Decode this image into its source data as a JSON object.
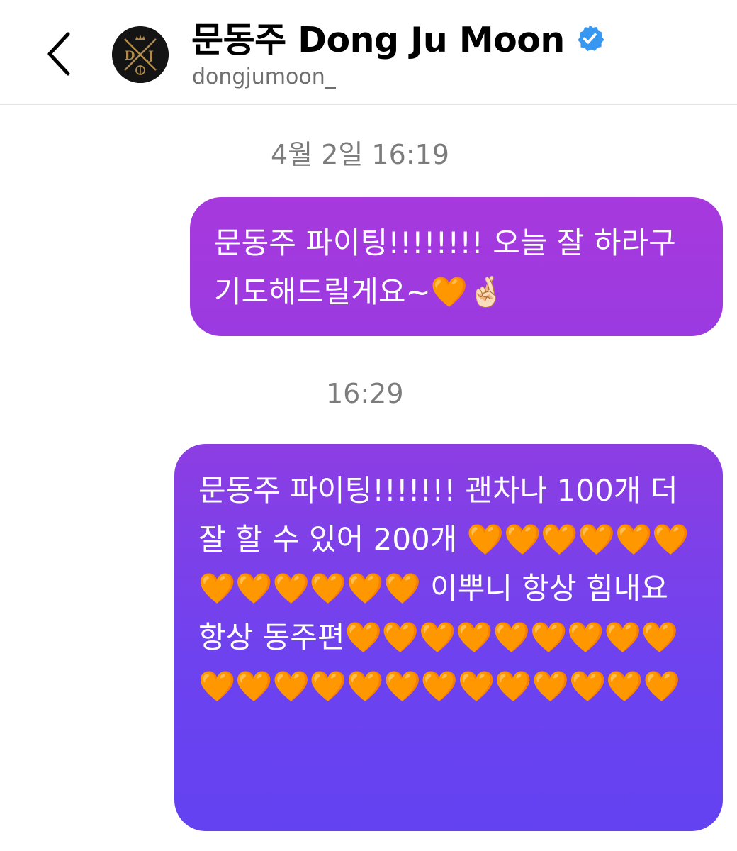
{
  "header": {
    "title": "문동주 Dong Ju Moon",
    "handle": "dongjumoon_",
    "back_icon": "chevron-left-icon",
    "verified_icon": "verified-badge-icon",
    "avatar_icon": "team-logo-avatar",
    "verified_color": "#3897f0"
  },
  "messages": [
    {
      "timestamp": "4월 2일 16:19",
      "text": "문동주 파이팅!!!!!!!! 오늘 잘 하라구 기도해드릴게요~🧡🤞🏻",
      "color": "#a33ade"
    },
    {
      "timestamp": "16:29",
      "text": "문동주 파이팅!!!!!!! 괜차나 100개 더 잘 할 수 있어 200개 🧡🧡🧡🧡🧡🧡🧡🧡🧡🧡🧡🧡 이뿌니 항상 힘내요 항상 동주편🧡🧡🧡🧡🧡🧡🧡🧡🧡🧡🧡🧡🧡🧡🧡🧡🧡🧡🧡🧡🧡🧡",
      "color": "#7a40ea"
    }
  ]
}
